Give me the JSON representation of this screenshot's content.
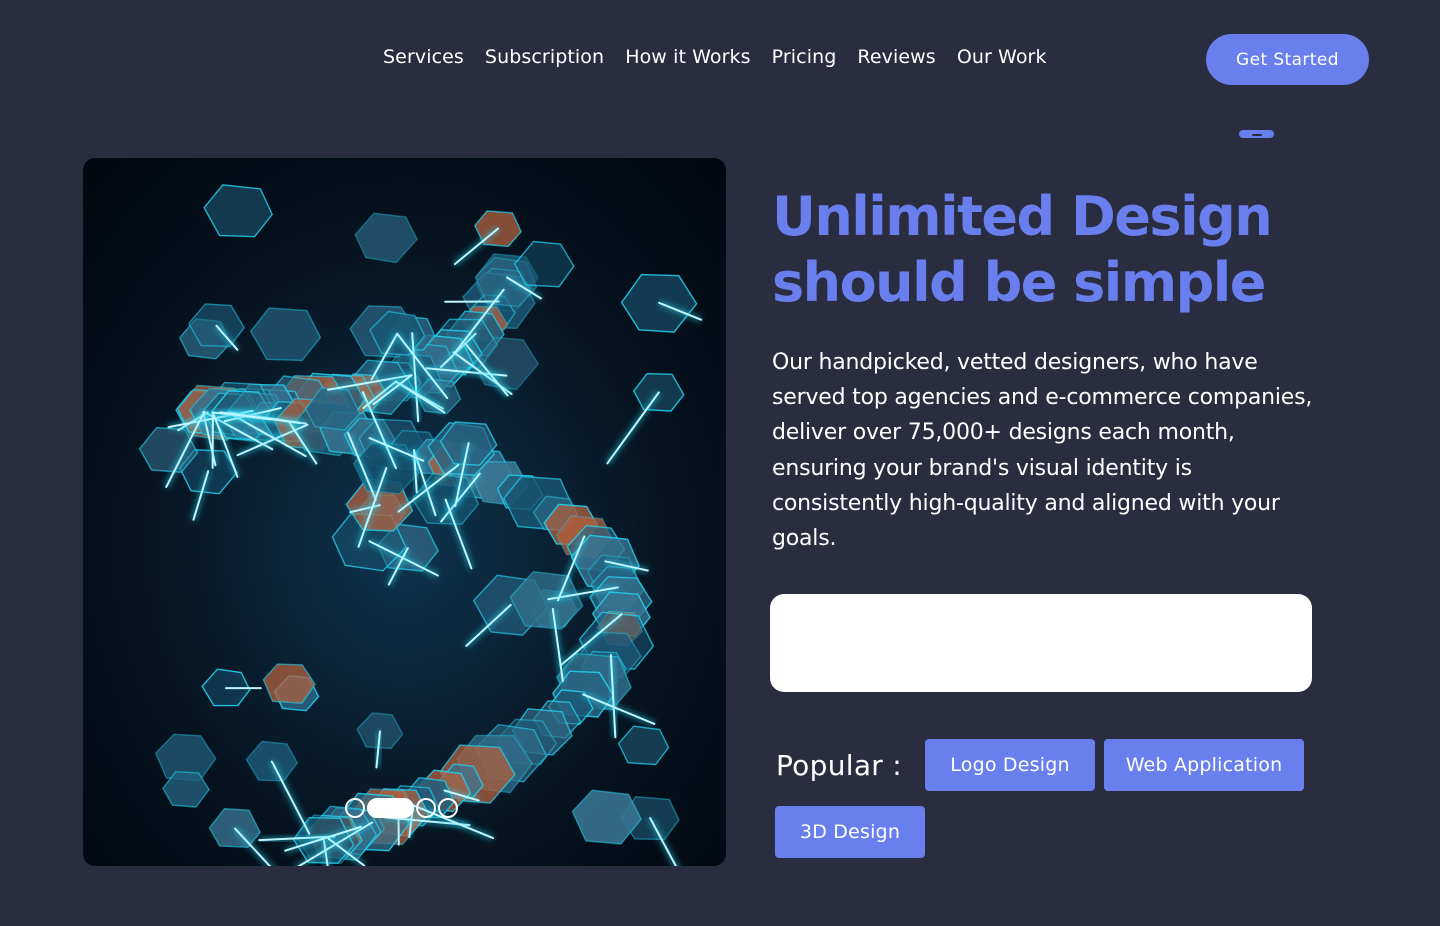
{
  "nav": {
    "links": [
      {
        "label": "Services"
      },
      {
        "label": "Subscription"
      },
      {
        "label": "How it Works"
      },
      {
        "label": "Pricing"
      },
      {
        "label": "Reviews"
      },
      {
        "label": "Our Work"
      }
    ],
    "cta_label": "Get Started"
  },
  "hero": {
    "image_icon": "neon-hexagon-sculpture-image",
    "carousel": {
      "slide_count": 4,
      "active_index": 1
    },
    "headline_line1": "Unlimited Design",
    "headline_line2": "should be simple",
    "description": "Our handpicked, vetted designers, who have served top agencies and e-commerce companies, deliver over 75,000+ designs each month, ensuring your brand's visual identity is consistently high-quality and aligned with your goals.",
    "search": {
      "value": "",
      "placeholder": ""
    },
    "popular_label": "Popular :",
    "popular_tags": [
      "Logo Design",
      "Web Application",
      "3D Design"
    ]
  },
  "colors": {
    "background": "#2a2d40",
    "accent": "#6a7fee",
    "text": "#ffffff",
    "neon": "#22d3f0",
    "copper": "#b0603f"
  }
}
